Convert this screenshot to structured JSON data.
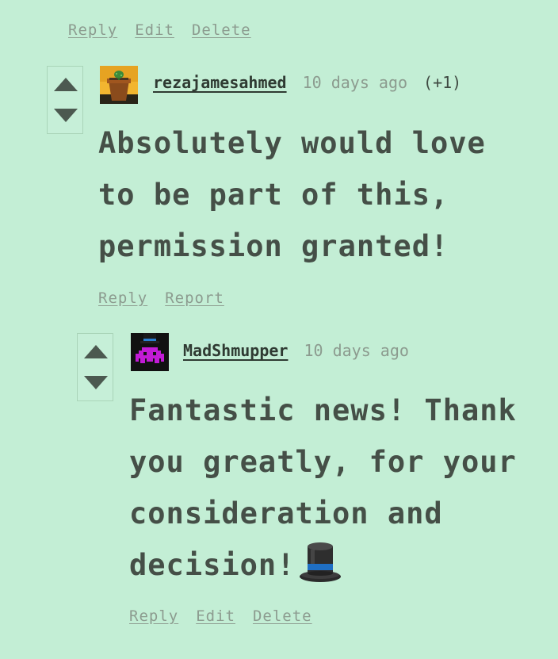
{
  "top_actions": {
    "reply": "Reply",
    "edit": "Edit",
    "delete": "Delete"
  },
  "comment1": {
    "username": "rezajamesahmed",
    "time": "10 days ago",
    "score": "(+1)",
    "avatar_icon": "plant-pot-icon",
    "body": "Absolutely would love to be part of this, permission granted!",
    "actions": {
      "reply": "Reply",
      "report": "Report"
    }
  },
  "comment2": {
    "username": "MadShmupper",
    "time": "10 days ago",
    "avatar_icon": "pixel-invader-top-hat-icon",
    "body": "Fantastic news! Thank you greatly, for your consideration and decision!",
    "emoji_icon": "top-hat-icon",
    "actions": {
      "reply": "Reply",
      "edit": "Edit",
      "delete": "Delete"
    }
  },
  "colors": {
    "background": "#c3eed5",
    "text": "#454f47",
    "muted": "#8c9b8f",
    "arrow": "#4c5950"
  }
}
